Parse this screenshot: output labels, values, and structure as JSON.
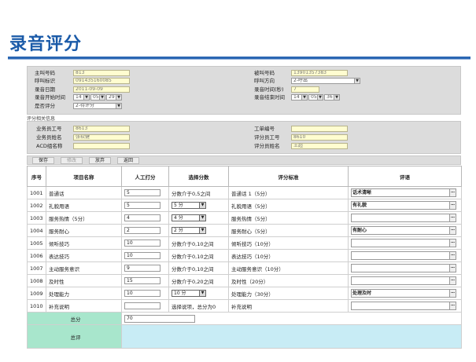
{
  "page": {
    "title": "录音评分"
  },
  "info": {
    "caller_label": "主叫号码",
    "caller_value": "813",
    "callee_label": "被叫号码",
    "callee_value": "13901357383",
    "callid_label": "呼叫标识",
    "callid_value": "091435160085",
    "direction_label": "呼叫方向",
    "direction_value": "2-呼出",
    "date_label": "录音日期",
    "date_value": "2011-09-09",
    "duration_label": "录音时间(秒)",
    "duration_value": "7",
    "start_label": "录音开始时间",
    "start_h": "14",
    "start_m": "05",
    "start_s": "29",
    "end_label": "录音结束时间",
    "end_h": "14",
    "end_m": "05",
    "end_s": "36",
    "evaluated_label": "是否评分",
    "evaluated_value": "2-待评分"
  },
  "eval": {
    "section_title": "评分相关信息",
    "agent_id_label": "业务员工号",
    "agent_id_value": "8613",
    "work_no_label": "工单编号",
    "work_no_value": "",
    "agent_name_label": "业务员姓名",
    "agent_name_value": "张软健",
    "rater_id_label": "评分员工号",
    "rater_id_value": "8610",
    "acd_label": "ACD组名称",
    "acd_value": "",
    "rater_name_label": "评分员姓名",
    "rater_name_value": "王超"
  },
  "toolbar": {
    "save": "保存",
    "modify": "修改",
    "discard": "放弃",
    "back": "返回"
  },
  "grid": {
    "headers": [
      "序号",
      "项目名称",
      "人工打分",
      "选择分数",
      "评分标准",
      "评语"
    ],
    "rows": [
      {
        "no": "1001",
        "name": "普通话",
        "score": "5",
        "select": "分数介于0,5之间",
        "std": "普通话 1（5分）",
        "comment": "话术清晰"
      },
      {
        "no": "1002",
        "name": "礼貌用语",
        "score": "5",
        "select": "5 分",
        "std": "礼貌用语（5分）",
        "comment": "有礼貌"
      },
      {
        "no": "1003",
        "name": "服务热情（5分）",
        "score": "4",
        "select": "4 分",
        "std": "服务热情（5分）",
        "comment": ""
      },
      {
        "no": "1004",
        "name": "服务耐心",
        "score": "2",
        "select": "2 分",
        "std": "服务耐心（5分）",
        "comment": "有耐心"
      },
      {
        "no": "1005",
        "name": "倾听技巧",
        "score": "10",
        "select": "分数介于0,10之间",
        "std": "倾听技巧（10分）",
        "comment": ""
      },
      {
        "no": "1006",
        "name": "表达技巧",
        "score": "10",
        "select": "分数介于0,10之间",
        "std": "表达技巧（10分）",
        "comment": ""
      },
      {
        "no": "1007",
        "name": "主动服务意识",
        "score": "9",
        "select": "分数介于0,10之间",
        "std": "主动服务意识（10分）",
        "comment": ""
      },
      {
        "no": "1008",
        "name": "及时性",
        "score": "15",
        "select": "分数介于0,20之间",
        "std": "及时性（20分）",
        "comment": ""
      },
      {
        "no": "1009",
        "name": "处理能力",
        "score": "10",
        "select": "10 分",
        "std": "处理能力（30分）",
        "comment": "处理及时"
      },
      {
        "no": "1010",
        "name": "补充说明",
        "score": "",
        "select": "选择说项，总分为0",
        "std": "补充说明",
        "comment": ""
      }
    ],
    "total_label": "总分",
    "total_value": "70",
    "summary_label": "总评",
    "summary_value": ""
  }
}
